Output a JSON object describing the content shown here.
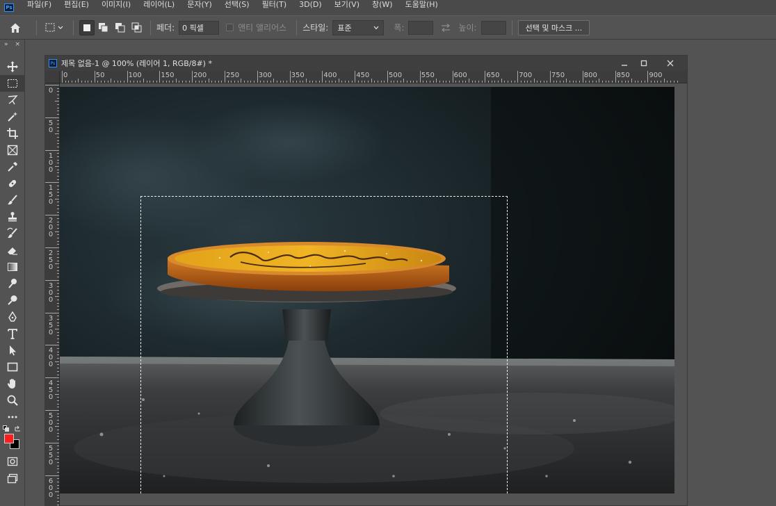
{
  "menu": {
    "items": [
      "파일(F)",
      "편집(E)",
      "이미지(I)",
      "레이어(L)",
      "문자(Y)",
      "선택(S)",
      "필터(T)",
      "3D(D)",
      "보기(V)",
      "창(W)",
      "도움말(H)"
    ]
  },
  "options": {
    "feather_label": "페더:",
    "feather_value": "0 픽셀",
    "antialias_label": "앤티 앨리어스",
    "style_label": "스타일:",
    "style_value": "표준",
    "width_label": "폭:",
    "height_label": "높이:",
    "select_mask_button": "선택 및 마스크 ..."
  },
  "document": {
    "title": "제목 없음-1 @ 100% (레이어 1, RGB/8#) *",
    "ruler_h_labels": [
      "0",
      "50",
      "100",
      "150",
      "200",
      "250",
      "300",
      "350",
      "400",
      "450",
      "500",
      "550",
      "600",
      "650",
      "700",
      "750",
      "800",
      "850",
      "900"
    ],
    "ruler_v_labels": [
      "0",
      "50",
      "100",
      "150",
      "200",
      "250",
      "300",
      "350",
      "400",
      "450",
      "500",
      "550",
      "600"
    ]
  },
  "colors": {
    "foreground": "#ff1e1e",
    "background": "#000000"
  },
  "tools": [
    "move-icon",
    "rectangular-marquee-icon",
    "lasso-icon",
    "magic-wand-icon",
    "crop-icon",
    "frame-icon",
    "eyedropper-icon",
    "healing-brush-icon",
    "brush-icon",
    "clone-stamp-icon",
    "history-brush-icon",
    "eraser-icon",
    "gradient-icon",
    "smudge-icon",
    "dodge-icon",
    "pen-icon",
    "type-icon",
    "path-selection-icon",
    "rectangle-icon",
    "hand-icon",
    "zoom-icon",
    "more-tools-icon"
  ]
}
